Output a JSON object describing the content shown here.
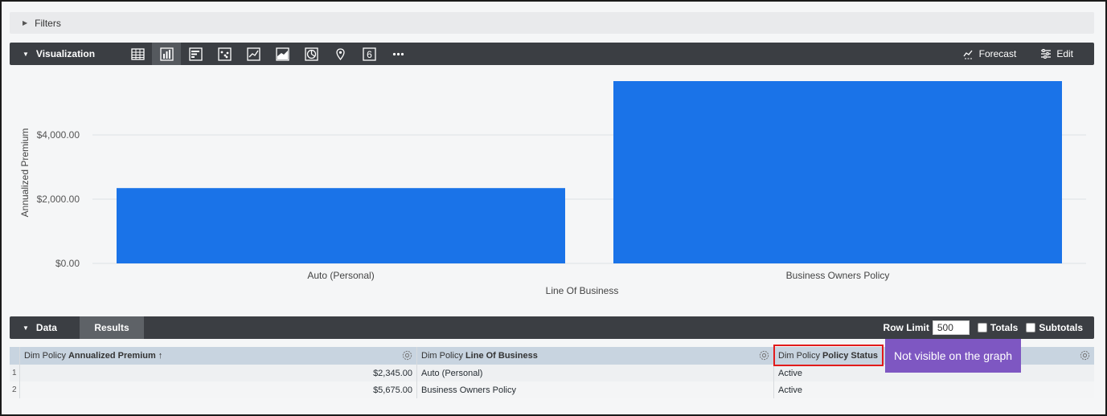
{
  "filters": {
    "label": "Filters"
  },
  "visualization": {
    "title": "Visualization",
    "icons": [
      "table-icon",
      "column-chart-icon",
      "bar-chart-icon",
      "scatter-icon",
      "line-chart-icon",
      "area-chart-icon",
      "pie-chart-icon",
      "map-pin-icon",
      "single-value-icon",
      "more-icon"
    ],
    "active_icon": "column-chart-icon",
    "single_value_glyph": "6",
    "forecast_label": "Forecast",
    "edit_label": "Edit"
  },
  "chart_data": {
    "type": "bar",
    "categories": [
      "Auto (Personal)",
      "Business Owners Policy"
    ],
    "values": [
      2345.0,
      5675.0
    ],
    "xlabel": "Line Of Business",
    "ylabel": "Annualized Premium",
    "yticks": [
      "$0.00",
      "$2,000.00",
      "$4,000.00"
    ],
    "ylim": [
      0,
      5900
    ],
    "grid": true,
    "bar_color": "#1a73e8"
  },
  "data_section": {
    "title": "Data",
    "results_tab": "Results",
    "row_limit_label": "Row Limit",
    "row_limit_value": "500",
    "totals_label": "Totals",
    "subtotals_label": "Subtotals"
  },
  "table": {
    "columns": [
      {
        "prefix": "Dim Policy",
        "name": "Annualized Premium ↑"
      },
      {
        "prefix": "Dim Policy",
        "name": "Line Of Business"
      },
      {
        "prefix": "Dim Policy",
        "name": "Policy Status"
      }
    ],
    "rows": [
      {
        "index": "1",
        "premium": "$2,345.00",
        "line": "Auto (Personal)",
        "status": "Active"
      },
      {
        "index": "2",
        "premium": "$5,675.00",
        "line": "Business Owners Policy",
        "status": "Active"
      }
    ]
  },
  "annotation": {
    "callout_text": "Not visible on the graph",
    "highlight_color": "#e21b1b",
    "callout_color": "#7e57c2"
  }
}
